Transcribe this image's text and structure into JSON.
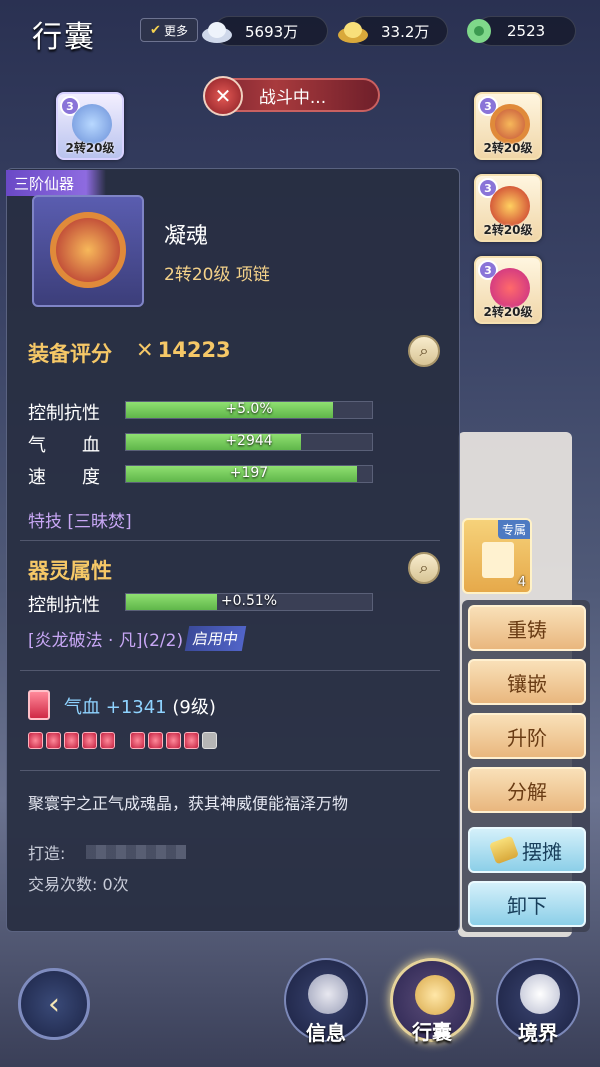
{
  "header": {
    "title": "行囊",
    "more_label": "更多",
    "currencies": [
      {
        "icon": "silver-ingot-icon",
        "value": "5693万"
      },
      {
        "icon": "gold-ingot-icon",
        "value": "33.2万"
      },
      {
        "icon": "jade-icon",
        "value": "2523"
      }
    ]
  },
  "battle_status": "战斗中...",
  "equip_slots": {
    "left": [
      {
        "level": "3",
        "label": "2转20级"
      }
    ],
    "right": [
      {
        "level": "3",
        "label": "2转20级"
      },
      {
        "level": "3",
        "label": "2转20级"
      },
      {
        "level": "3",
        "label": "2转20级"
      }
    ]
  },
  "detail": {
    "rank_tag": "三阶仙器",
    "name": "凝魂",
    "subtitle": "2转20级  项链",
    "score_label": "装备评分",
    "score_value": "14223",
    "stats": [
      {
        "label": "控制抗性",
        "value": "+5.0%",
        "fill": 0.84
      },
      {
        "label": "气　　血",
        "value": "+2944",
        "fill": 0.71
      },
      {
        "label": "速　　度",
        "value": "+197",
        "fill": 0.94
      }
    ],
    "skill": "特技 [三昧焚]",
    "spirit_title": "器灵属性",
    "spirit_stat": {
      "label": "控制抗性",
      "value": "+0.51%",
      "fill": 0.37
    },
    "spirit_effect": "[炎龙破法 · 凡](2/2)",
    "active_badge": "启用中",
    "gem_label": "气血",
    "gem_value": "+1341",
    "gem_level": "(9级)",
    "gem_filled": 9,
    "gem_total": 10,
    "description": "聚寰宇之正气成魂晶，获其神威便能福泽万物",
    "forge_label": "打造:",
    "trade_label": "交易次数:",
    "trade_value": "0次"
  },
  "inventory": {
    "exclusive_ribbon": "专属",
    "exclusive_count": "4"
  },
  "actions": [
    "重铸",
    "镶嵌",
    "升阶",
    "分解",
    "摆摊",
    "卸下"
  ],
  "nav": {
    "info": "信息",
    "bag": "行囊",
    "realm": "境界"
  },
  "colors": {
    "accent_gold": "#f6c867",
    "bar_green": "#6fcc55",
    "purple_text": "#c8a7f5",
    "gem_blue": "#8fd3ff"
  }
}
